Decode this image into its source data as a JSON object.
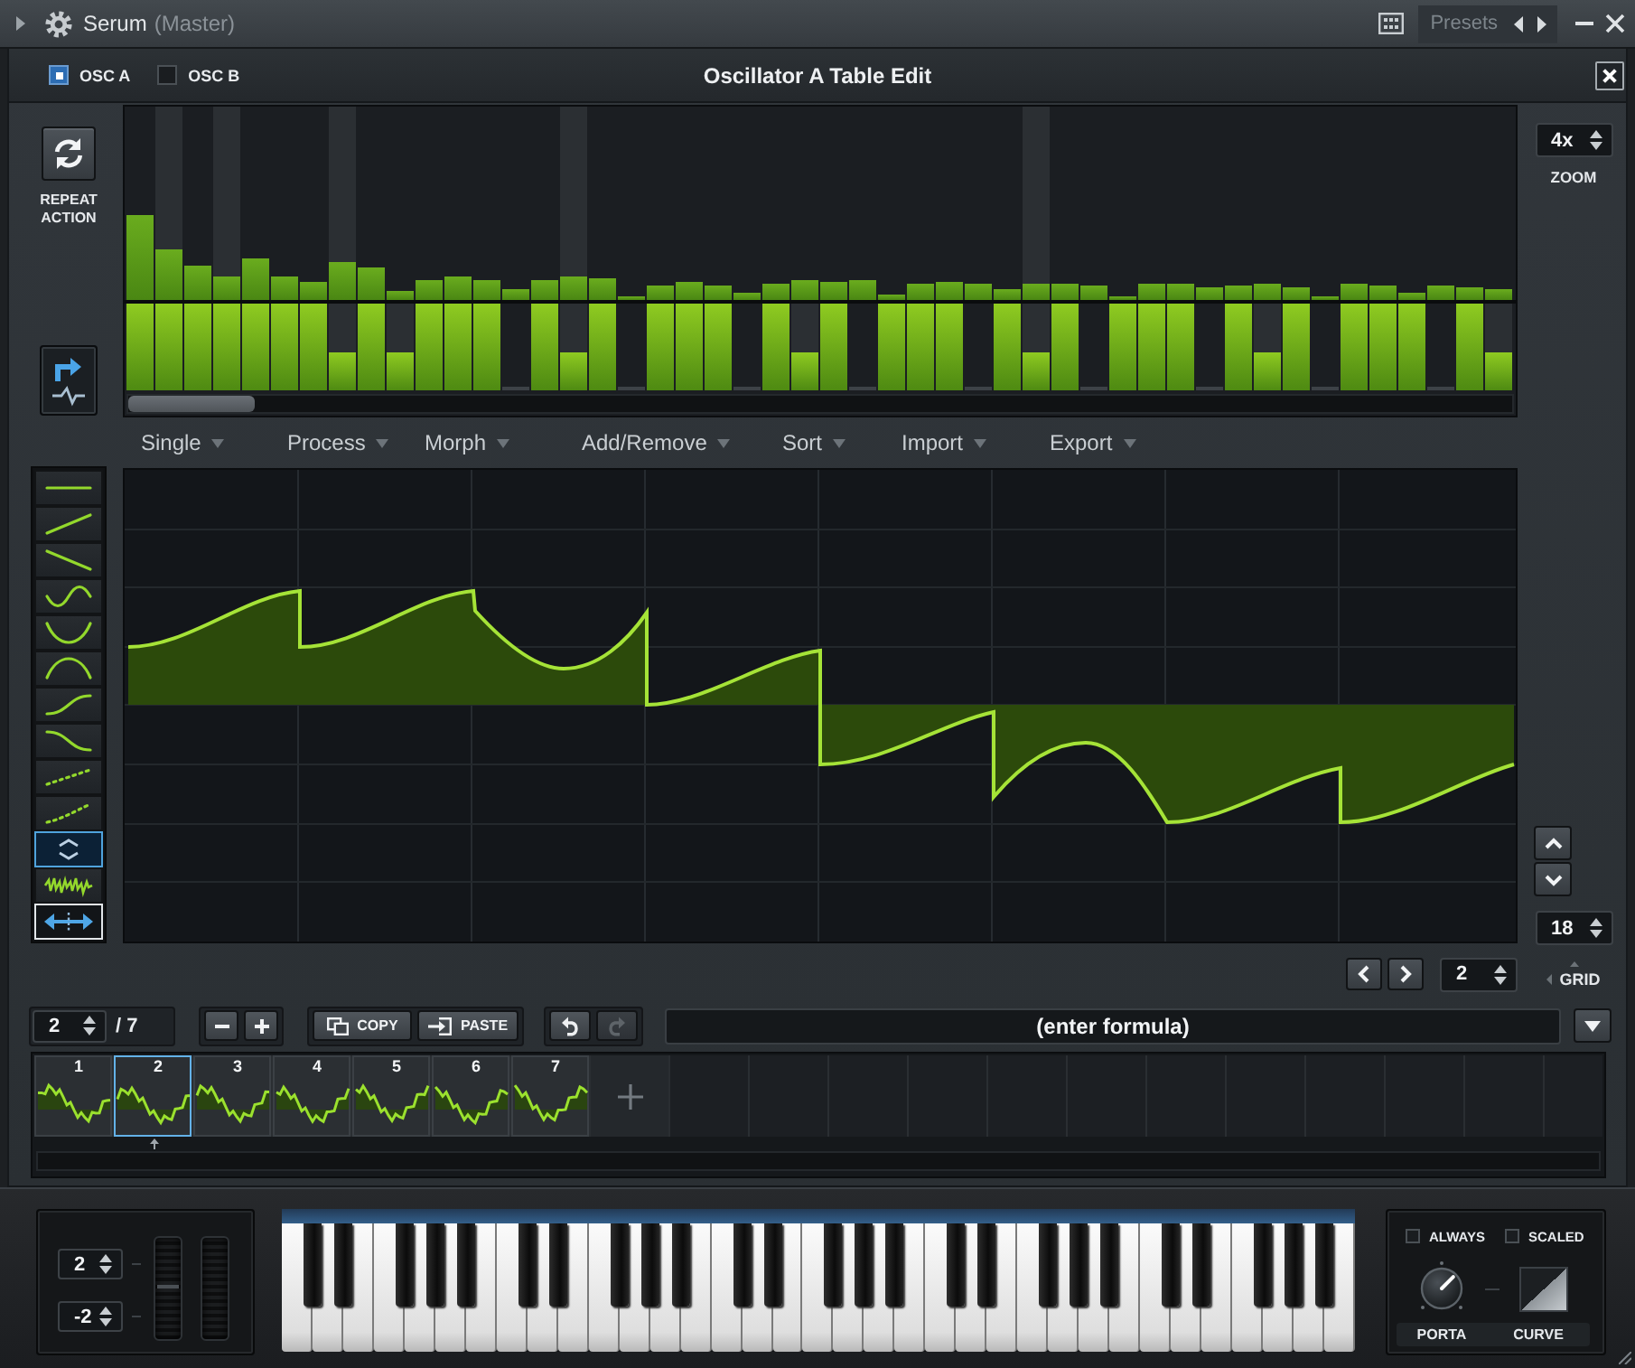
{
  "title_bar": {
    "plugin_name": "Serum",
    "channel": "(Master)",
    "presets_label": "Presets"
  },
  "header": {
    "oscillators": [
      {
        "label": "OSC A",
        "checked": true
      },
      {
        "label": "OSC B",
        "checked": false
      }
    ],
    "title": "Oscillator A Table Edit"
  },
  "repeat_action": {
    "label": "REPEAT ACTION"
  },
  "zoom": {
    "value": "4x",
    "label": "ZOOM"
  },
  "menu": [
    {
      "label": "Single"
    },
    {
      "label": "Process"
    },
    {
      "label": "Morph"
    },
    {
      "label": "Add/Remove"
    },
    {
      "label": "Sort"
    },
    {
      "label": "Import"
    },
    {
      "label": "Export"
    }
  ],
  "tools": [
    {
      "selected": false
    },
    {
      "selected": false
    },
    {
      "selected": false
    },
    {
      "selected": false
    },
    {
      "selected": false
    },
    {
      "selected": false
    },
    {
      "selected": false
    },
    {
      "selected": false
    },
    {
      "selected": false
    },
    {
      "selected": false
    },
    {
      "selected": true
    },
    {
      "selected": false
    }
  ],
  "mode_toggle": {
    "on": true
  },
  "grid": {
    "value": "18",
    "label": "GRID"
  },
  "step_spinner": {
    "value": "2"
  },
  "frame_counter": {
    "current": "2",
    "total": "/ 7"
  },
  "edit_buttons": [
    {
      "label": "COPY"
    },
    {
      "label": "PASTE"
    }
  ],
  "history_buttons": [
    {
      "disabled": false
    },
    {
      "disabled": true
    }
  ],
  "formula": {
    "placeholder": "(enter formula)"
  },
  "frames": [
    {
      "number": "1",
      "selected": false
    },
    {
      "number": "2",
      "selected": true
    },
    {
      "number": "3",
      "selected": false
    },
    {
      "number": "4",
      "selected": false
    },
    {
      "number": "5",
      "selected": false
    },
    {
      "number": "6",
      "selected": false
    },
    {
      "number": "7",
      "selected": false
    }
  ],
  "pitch_range": [
    {
      "value": "2"
    },
    {
      "value": "-2"
    }
  ],
  "portamento": {
    "options": [
      {
        "label": "ALWAYS",
        "checked": false
      },
      {
        "label": "SCALED",
        "checked": false
      }
    ],
    "knob_label": "PORTA",
    "curve_label": "CURVE"
  }
}
